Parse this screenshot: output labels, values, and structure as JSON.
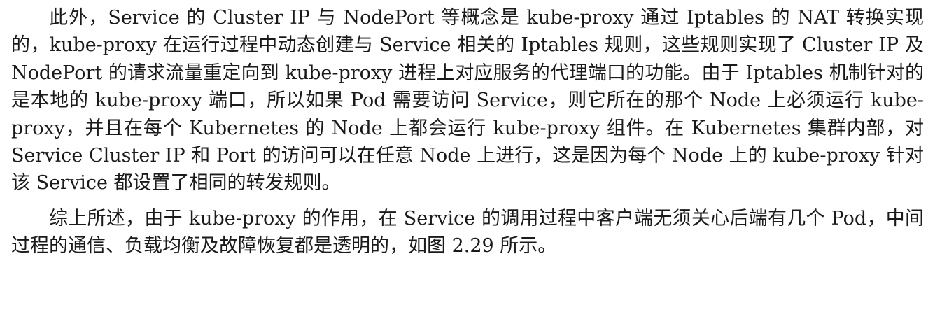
{
  "document": {
    "paragraphs": [
      "此外，Service 的 Cluster IP 与 NodePort 等概念是 kube-proxy 通过 Iptables 的 NAT 转换实现的，kube-proxy 在运行过程中动态创建与 Service 相关的 Iptables 规则，这些规则实现了 Cluster IP 及 NodePort 的请求流量重定向到 kube-proxy 进程上对应服务的代理端口的功能。由于 Iptables 机制针对的是本地的 kube-proxy 端口，所以如果 Pod 需要访问 Service，则它所在的那个 Node 上必须运行 kube-proxy，并且在每个 Kubernetes 的 Node 上都会运行 kube-proxy 组件。在 Kubernetes 集群内部，对 Service Cluster IP 和 Port 的访问可以在任意 Node 上进行，这是因为每个 Node 上的 kube-proxy 针对该 Service 都设置了相同的转发规则。",
      "综上所述，由于 kube-proxy 的作用，在 Service 的调用过程中客户端无须关心后端有几个 Pod，中间过程的通信、负载均衡及故障恢复都是透明的，如图 2.29 所示。"
    ]
  }
}
